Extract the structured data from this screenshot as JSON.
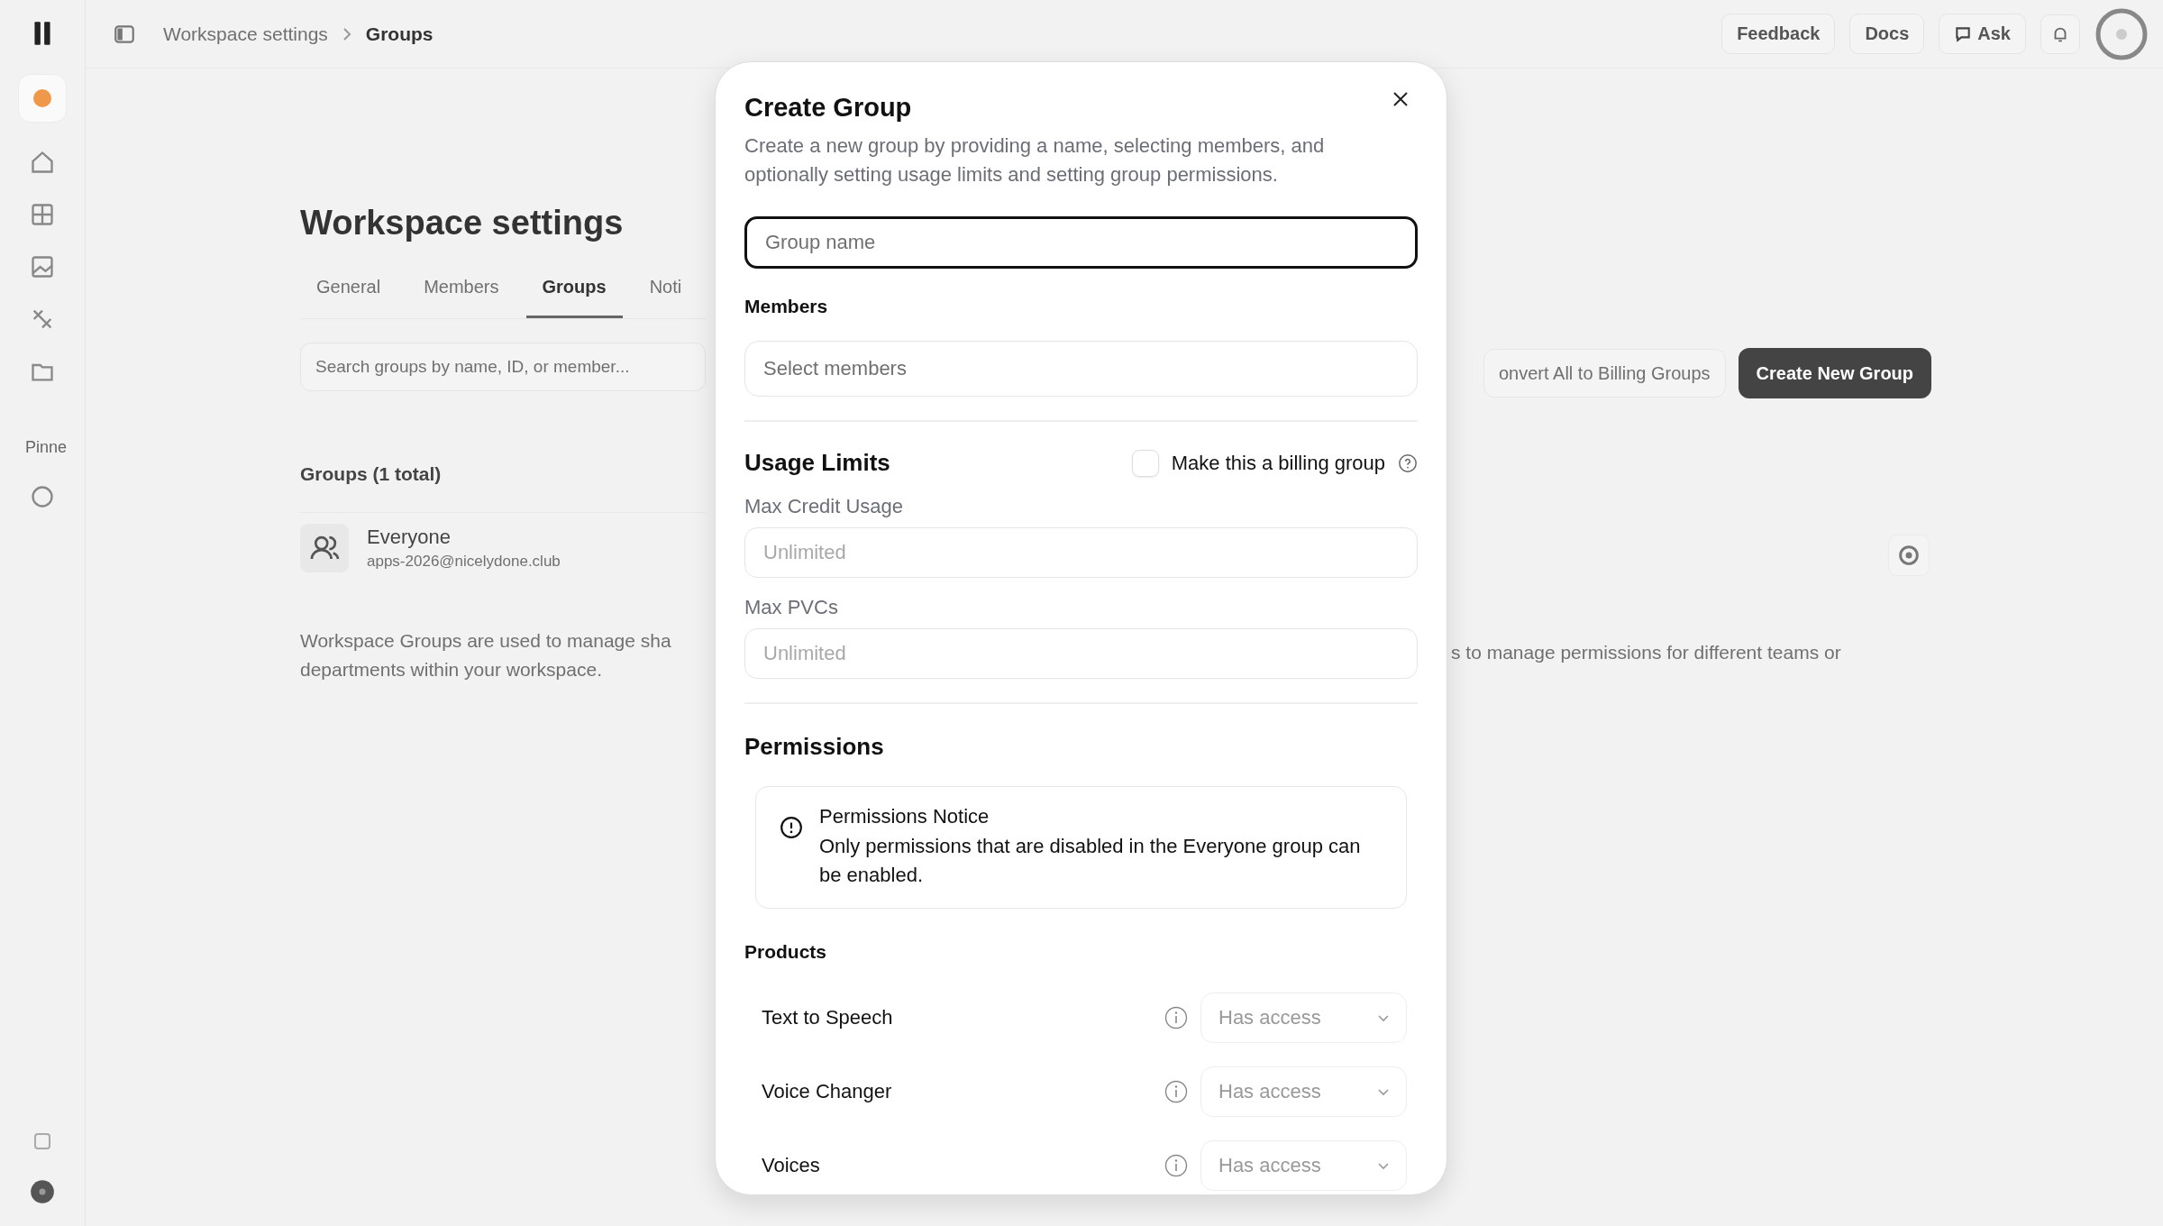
{
  "sidebar": {
    "section_label": "Pinne"
  },
  "topbar": {
    "breadcrumb": [
      "Workspace settings",
      "Groups"
    ],
    "buttons": [
      "Feedback",
      "Docs",
      "Ask"
    ]
  },
  "page": {
    "title": "Workspace settings",
    "tabs": [
      {
        "label": "General",
        "selected": false
      },
      {
        "label": "Members",
        "selected": false
      },
      {
        "label": "Groups",
        "selected": true
      },
      {
        "label": "Noti",
        "selected": false
      }
    ],
    "search": {
      "placeholder": "Search groups by name, ID, or member..."
    },
    "convert_button": "onvert All to Billing Groups",
    "create_button": "Create New Group",
    "groups_heading": "Groups (1 total)",
    "groups": [
      {
        "name": "Everyone",
        "email": "apps-2026@nicelydone.club"
      }
    ],
    "description_left": [
      "Workspace Groups are used to manage sha",
      "departments within your workspace."
    ],
    "description_right": "s to manage permissions for different teams or"
  },
  "modal": {
    "title": "Create Group",
    "description": "Create a new group by providing a name, selecting members, and optionally setting usage limits and setting group permissions.",
    "name_field": {
      "placeholder": "Group name"
    },
    "members_label": "Members",
    "members_field": {
      "placeholder": "Select members"
    },
    "usage_title": "Usage Limits",
    "billing": {
      "label": "Make this a billing group",
      "checked": false
    },
    "limits": [
      {
        "label": "Max Credit Usage",
        "placeholder": "Unlimited"
      },
      {
        "label": "Max PVCs",
        "placeholder": "Unlimited"
      }
    ],
    "permissions_title": "Permissions",
    "notice": {
      "title": "Permissions Notice",
      "text": "Only permissions that are disabled in the Everyone group can be enabled."
    },
    "products_label": "Products",
    "products": [
      {
        "name": "Text to Speech",
        "value": "Has access"
      },
      {
        "name": "Voice Changer",
        "value": "Has access"
      },
      {
        "name": "Voices",
        "value": "Has access"
      }
    ]
  }
}
